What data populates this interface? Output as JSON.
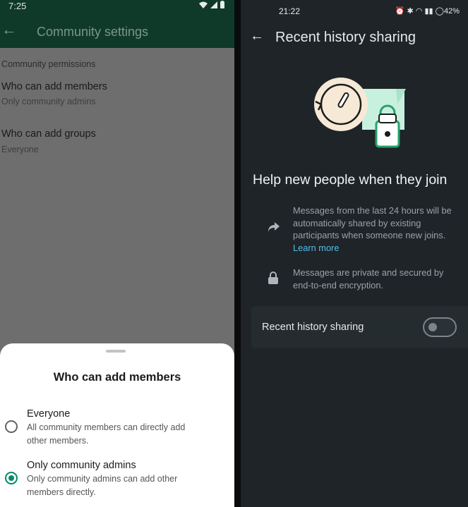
{
  "left": {
    "status_time": "7:25",
    "appbar_title": "Community settings",
    "section_label": "Community permissions",
    "rows": [
      {
        "title": "Who can add members",
        "subtitle": "Only community admins"
      },
      {
        "title": "Who can add groups",
        "subtitle": "Everyone"
      }
    ],
    "sheet": {
      "title": "Who can add members",
      "options": [
        {
          "title": "Everyone",
          "desc": "All community members can directly add other members.",
          "selected": false
        },
        {
          "title": "Only community admins",
          "desc": "Only community admins can add other members directly.",
          "selected": true
        }
      ]
    }
  },
  "right": {
    "status_time": "21:22",
    "status_battery": "42%",
    "title": "Recent history sharing",
    "heading": "Help new people when they join",
    "info": [
      {
        "icon": "forward-arrow-icon",
        "text": "Messages from the last 24 hours will be automatically shared by existing participants when someone new joins.",
        "link": "Learn more"
      },
      {
        "icon": "lock-icon",
        "text": "Messages are private and secured by end-to-end encryption."
      }
    ],
    "toggle": {
      "label": "Recent history sharing",
      "on": false
    }
  },
  "colors": {
    "wa_green_dark": "#0f3a2a",
    "accent_green": "#008a6a",
    "link_blue": "#53bdeb",
    "dark_bg": "#1e2428"
  }
}
